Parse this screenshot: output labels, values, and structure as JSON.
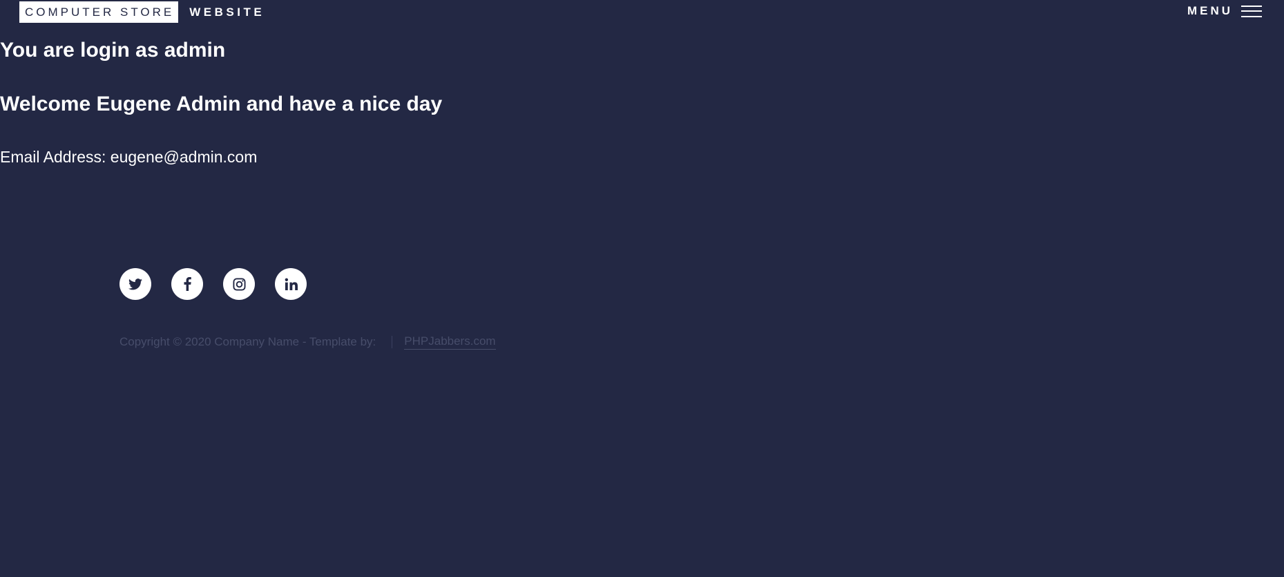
{
  "header": {
    "logo_highlight": "COMPUTER STORE",
    "logo_text": "WEBSITE",
    "menu_label": "MENU"
  },
  "main": {
    "login_heading": "You are login as admin",
    "welcome_heading": "Welcome Eugene Admin and have a nice day",
    "email_label": "Email Address:",
    "email_value": "eugene@admin.com"
  },
  "footer": {
    "socials": [
      {
        "icon": "twitter-icon"
      },
      {
        "icon": "facebook-icon"
      },
      {
        "icon": "instagram-icon"
      },
      {
        "icon": "linkedin-icon"
      }
    ],
    "copyright": "Copyright © 2020 Company Name - Template by:",
    "credit_link": "PHPJabbers.com"
  },
  "colors": {
    "background": "#232844",
    "text": "#ffffff",
    "muted_text": "#474d6a"
  }
}
